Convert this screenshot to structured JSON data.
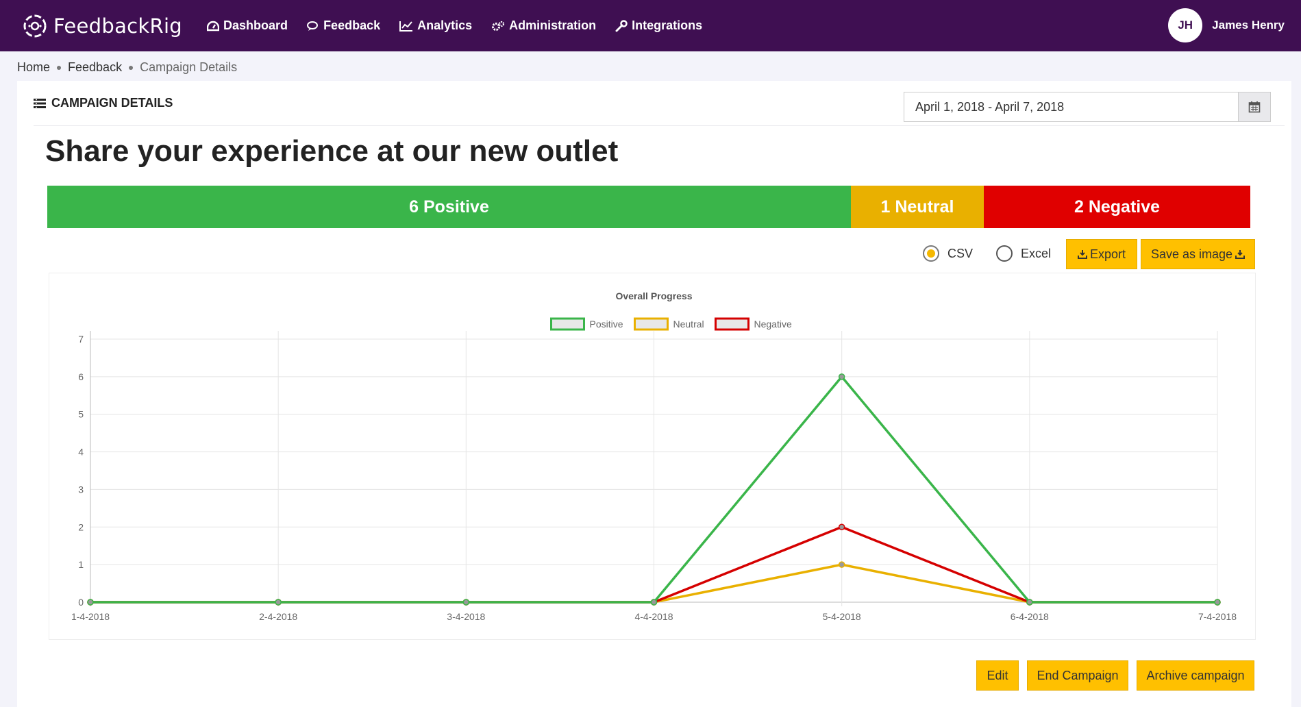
{
  "app": {
    "brand": "FeedbackRig",
    "nav": [
      {
        "label": "Dashboard",
        "icon": "dashboard-icon"
      },
      {
        "label": "Feedback",
        "icon": "comments-icon"
      },
      {
        "label": "Analytics",
        "icon": "line-chart-icon"
      },
      {
        "label": "Administration",
        "icon": "cogs-icon"
      },
      {
        "label": "Integrations",
        "icon": "wrench-icon"
      }
    ],
    "user": {
      "initials": "JH",
      "name": "James Henry"
    }
  },
  "breadcrumb": [
    "Home",
    "Feedback",
    "Campaign Details"
  ],
  "card": {
    "title": "CAMPAIGN DETAILS",
    "date_range": "April 1, 2018 - April 7, 2018"
  },
  "campaign": {
    "headline": "Share your experience at our new outlet",
    "summary": {
      "positive": "6 Positive",
      "neutral": "1 Neutral",
      "negative": "2 Negative"
    }
  },
  "export": {
    "formats": [
      "CSV",
      "Excel"
    ],
    "selected": "CSV",
    "export_label": "Export",
    "save_image_label": "Save as image"
  },
  "actions": {
    "edit": "Edit",
    "end": "End Campaign",
    "archive": "Archive campaign"
  },
  "colors": {
    "positive": "#3ab54a",
    "neutral": "#e9b000",
    "negative": "#d50000",
    "accent": "#ffc000",
    "nav_bg": "#3f0f52"
  },
  "chart_data": {
    "type": "line",
    "title": "Overall Progress",
    "x": [
      "1-4-2018",
      "2-4-2018",
      "3-4-2018",
      "4-4-2018",
      "5-4-2018",
      "6-4-2018",
      "7-4-2018"
    ],
    "series": [
      {
        "name": "Positive",
        "values": [
          0,
          0,
          0,
          0,
          6,
          0,
          0
        ]
      },
      {
        "name": "Neutral",
        "values": [
          0,
          0,
          0,
          0,
          1,
          0,
          0
        ]
      },
      {
        "name": "Negative",
        "values": [
          0,
          0,
          0,
          0,
          2,
          0,
          0
        ]
      }
    ],
    "yticks": [
      0,
      1,
      2,
      3,
      4,
      5,
      6,
      7
    ],
    "ylim": [
      0,
      7
    ],
    "grid": true,
    "legend": "top"
  }
}
